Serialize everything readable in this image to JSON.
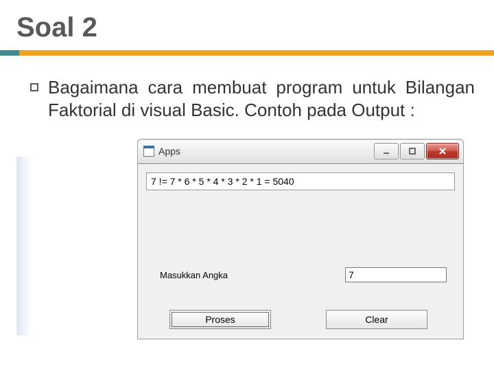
{
  "slide": {
    "title": "Soal 2",
    "paragraph": "Bagaimana cara membuat program untuk Bilangan Faktorial di visual Basic. Contoh pada Output :"
  },
  "window": {
    "title": "Apps",
    "output": "7 != 7 * 6 * 5 * 4 * 3 * 2 * 1 = 5040",
    "input_label": "Masukkan Angka",
    "input_value": "7",
    "buttons": {
      "proses": "Proses",
      "clear": "Clear"
    }
  }
}
